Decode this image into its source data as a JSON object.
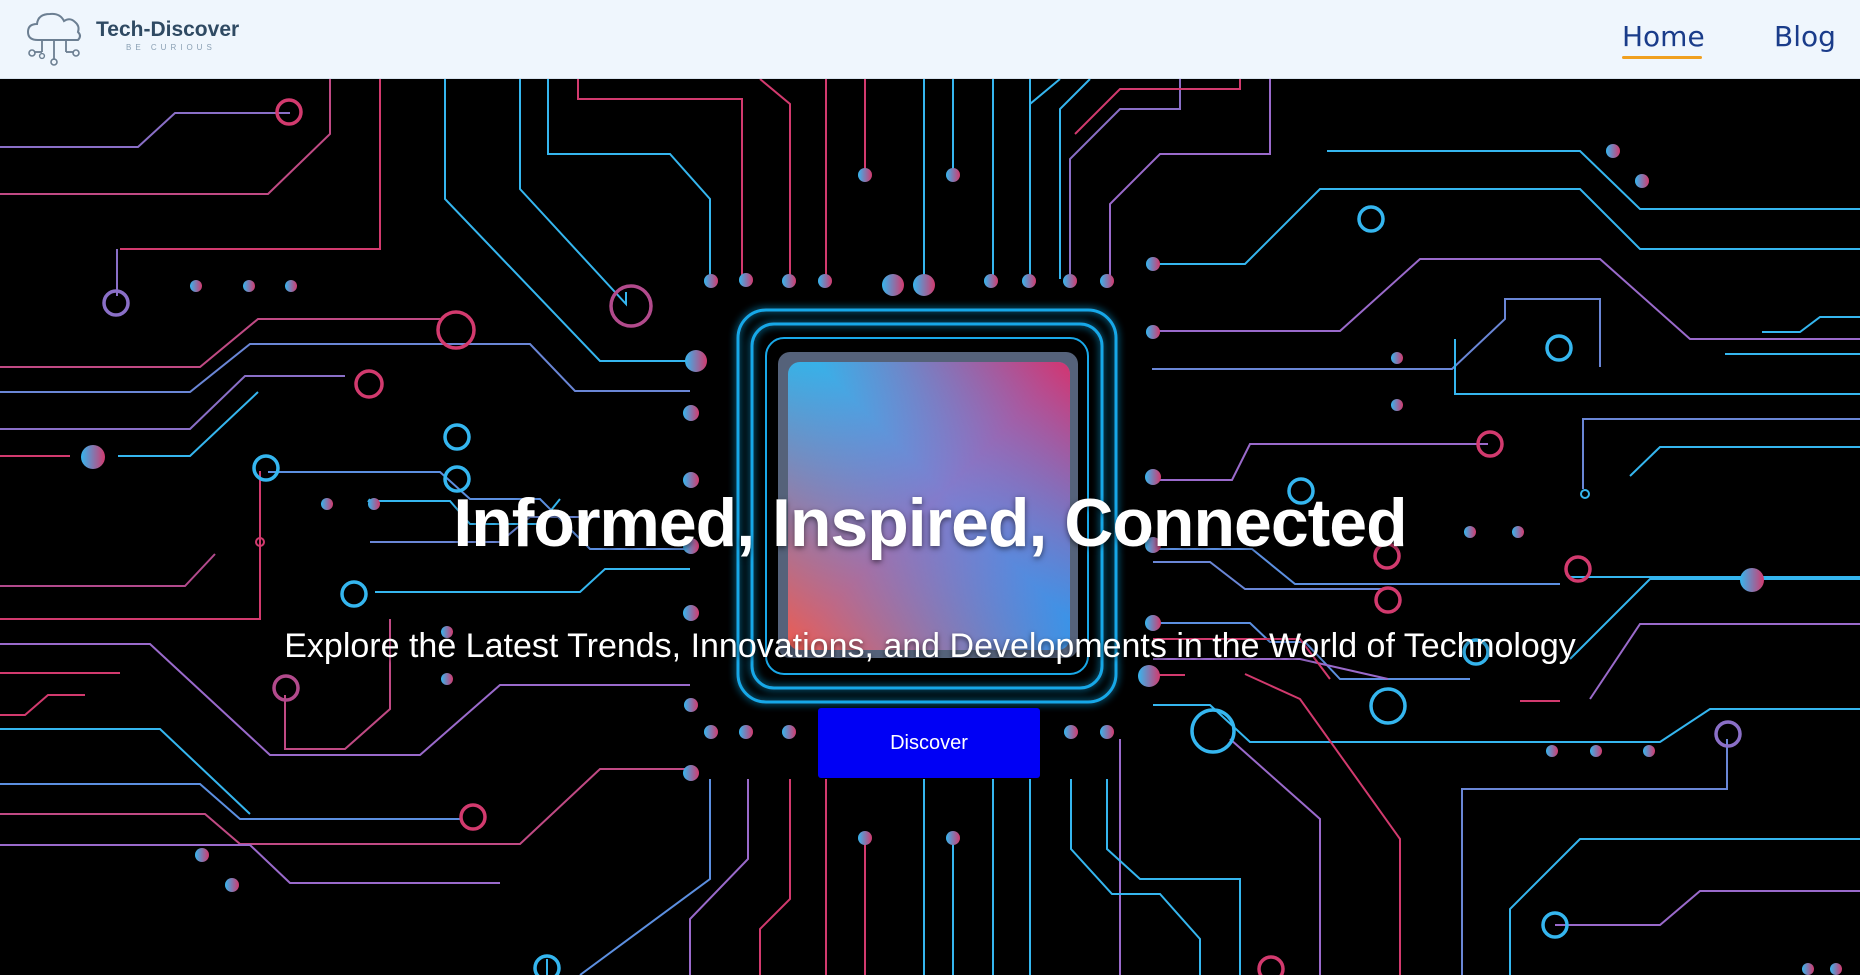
{
  "navbar": {
    "brand": {
      "name": "Tech-Discover",
      "tagline": "BE CURIOUS",
      "logo_icon": "cloud-network-icon"
    },
    "links": [
      {
        "label": "Home",
        "active": true
      },
      {
        "label": "Blog",
        "active": false
      }
    ],
    "colors": {
      "background": "#eff6fd",
      "link": "#1a3c8a",
      "active_underline": "#f0a020"
    }
  },
  "hero": {
    "background_image": "circuit-board-chip-illustration",
    "title": "Informed, Inspired, Connected",
    "subtitle": "Explore the Latest Trends, Innovations, and Developments in the World of Technology",
    "cta_label": "Discover",
    "colors": {
      "cta": "#0000f5",
      "trace_blue": "#35b6ef",
      "trace_pink": "#d23a6e",
      "text": "#ffffff"
    }
  }
}
